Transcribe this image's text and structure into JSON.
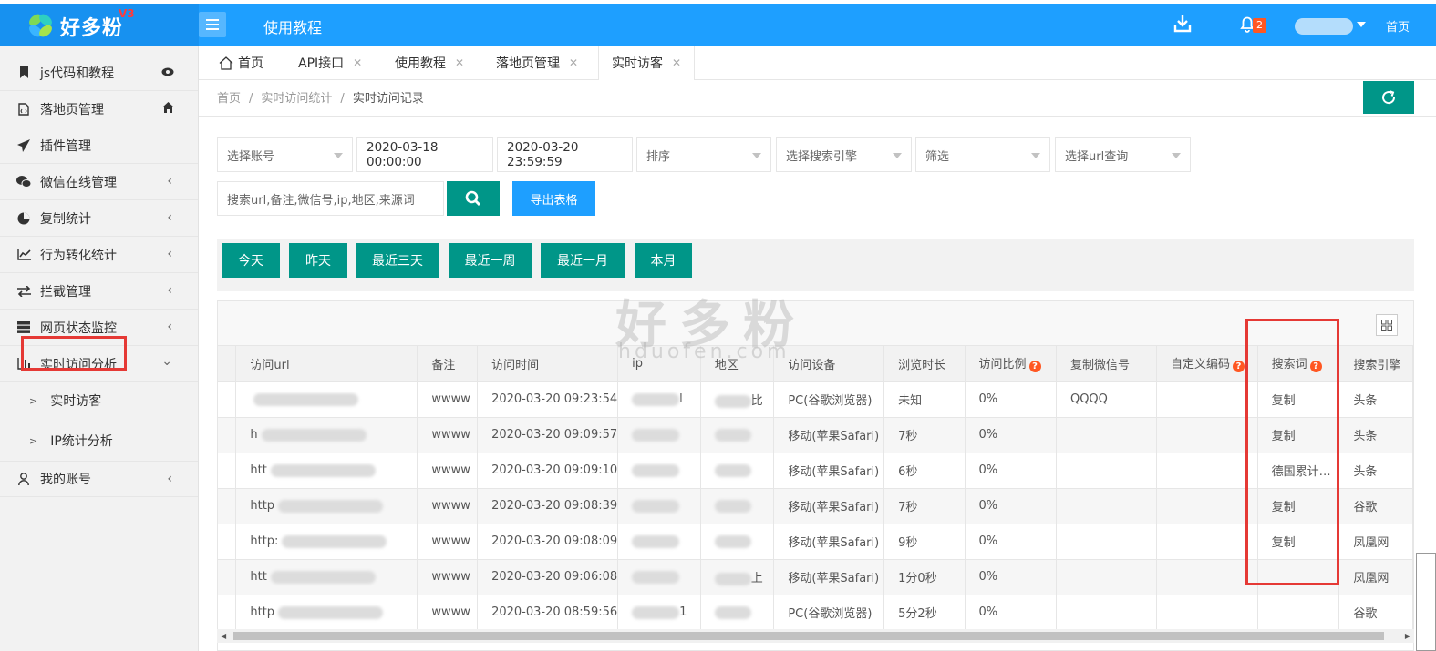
{
  "brand": {
    "name": "好多粉",
    "version": "V3"
  },
  "header": {
    "title": "使用教程",
    "notification_count": "2",
    "home_label": "首页"
  },
  "sidebar": {
    "items": [
      {
        "label": "js代码和教程",
        "icon": "bookmark-icon"
      },
      {
        "label": "落地页管理",
        "icon": "file-code-icon"
      },
      {
        "label": "插件管理",
        "icon": "paper-plane-icon"
      },
      {
        "label": "微信在线管理",
        "icon": "wechat-icon"
      },
      {
        "label": "复制统计",
        "icon": "pie-chart-icon"
      },
      {
        "label": "行为转化统计",
        "icon": "line-chart-icon"
      },
      {
        "label": "拦截管理",
        "icon": "exchange-icon"
      },
      {
        "label": "网页状态监控",
        "icon": "server-icon"
      },
      {
        "label": "实时访问分析",
        "icon": "bar-chart-icon"
      },
      {
        "label": "我的账号",
        "icon": "user-icon"
      }
    ],
    "subitems": [
      {
        "label": "实时访客"
      },
      {
        "label": "IP统计分析"
      }
    ]
  },
  "tabs": [
    {
      "label": "首页"
    },
    {
      "label": "API接口"
    },
    {
      "label": "使用教程"
    },
    {
      "label": "落地页管理"
    },
    {
      "label": "实时访客"
    }
  ],
  "breadcrumb": {
    "home": "首页",
    "level1": "实时访问统计",
    "current": "实时访问记录",
    "sep": "/"
  },
  "filters": {
    "account_placeholder": "选择账号",
    "start_time": "2020-03-18 00:00:00",
    "end_time": "2020-03-20 23:59:59",
    "sort_placeholder": "排序",
    "engine_placeholder": "选择搜索引擎",
    "filter_placeholder": "筛选",
    "url_placeholder": "选择url查询",
    "search_placeholder": "搜索url,备注,微信号,ip,地区,来源词",
    "export_label": "导出表格"
  },
  "quick_ranges": [
    "今天",
    "昨天",
    "最近三天",
    "最近一周",
    "最近一月",
    "本月"
  ],
  "watermark": {
    "text": "好多粉",
    "domain": "hduofen.com"
  },
  "table": {
    "columns": [
      "访问url",
      "备注",
      "访问时间",
      "ip",
      "地区",
      "访问设备",
      "浏览时长",
      "访问比例",
      "复制微信号",
      "自定义编码",
      "搜索词",
      "搜索引擎"
    ],
    "rows": [
      {
        "url": "",
        "note": "wwww",
        "time": "2020-03-20 09:23:54",
        "ip": "l",
        "region": "比",
        "device": "PC(谷歌浏览器)",
        "duration": "未知",
        "ratio": "0%",
        "wechat": "QQQQ",
        "code": "",
        "keyword": "复制",
        "engine": "头条"
      },
      {
        "url": "h",
        "note": "wwww",
        "time": "2020-03-20 09:09:57",
        "ip": "",
        "region": "",
        "device": "移动(苹果Safari)",
        "duration": "7秒",
        "ratio": "0%",
        "wechat": "",
        "code": "",
        "keyword": "复制",
        "engine": "头条"
      },
      {
        "url": "htt",
        "note": "wwww",
        "time": "2020-03-20 09:09:10",
        "ip": "",
        "region": "",
        "device": "移动(苹果Safari)",
        "duration": "6秒",
        "ratio": "0%",
        "wechat": "",
        "code": "",
        "keyword": "德国累计…",
        "engine": "头条"
      },
      {
        "url": "http",
        "note": "wwww",
        "time": "2020-03-20 09:08:39",
        "ip": "",
        "region": "",
        "device": "移动(苹果Safari)",
        "duration": "7秒",
        "ratio": "0%",
        "wechat": "",
        "code": "",
        "keyword": "复制",
        "engine": "谷歌"
      },
      {
        "url": "http:",
        "note": "wwww",
        "time": "2020-03-20 09:08:09",
        "ip": "",
        "region": "",
        "device": "移动(苹果Safari)",
        "duration": "9秒",
        "ratio": "0%",
        "wechat": "",
        "code": "",
        "keyword": "复制",
        "engine": "凤凰网"
      },
      {
        "url": "htt",
        "note": "wwww",
        "time": "2020-03-20 09:06:08",
        "ip": "",
        "region": "上",
        "device": "移动(苹果Safari)",
        "duration": "1分0秒",
        "ratio": "0%",
        "wechat": "",
        "code": "",
        "keyword": "",
        "engine": "凤凰网"
      },
      {
        "url": "http",
        "note": "wwww",
        "time": "2020-03-20 08:59:56",
        "ip": "1",
        "region": "",
        "device": "PC(谷歌浏览器)",
        "duration": "5分2秒",
        "ratio": "0%",
        "wechat": "",
        "code": "",
        "keyword": "",
        "engine": "谷歌"
      }
    ]
  },
  "colors": {
    "header_blue": "#1e9fff",
    "teal": "#009688",
    "highlight_red": "#e53935",
    "badge_orange": "#ff5722"
  }
}
